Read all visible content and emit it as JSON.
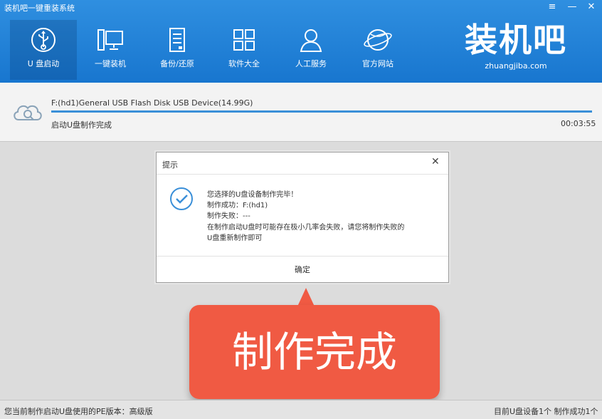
{
  "titlebar": {
    "app_title": "装机吧一键重装系统",
    "menu_icon": "≡",
    "minimize_icon": "—",
    "close_icon": "✕"
  },
  "nav": [
    {
      "label": "U 盘启动",
      "icon": "usb-icon",
      "active": true
    },
    {
      "label": "一键装机",
      "icon": "computer-icon"
    },
    {
      "label": "备份/还原",
      "icon": "backup-icon"
    },
    {
      "label": "软件大全",
      "icon": "apps-grid-icon"
    },
    {
      "label": "人工服务",
      "icon": "person-icon"
    },
    {
      "label": "官方网站",
      "icon": "globe-icon"
    }
  ],
  "brand": {
    "logo_text": "装机吧",
    "url": "zhuangjiba.com"
  },
  "device": {
    "name": "F:(hd1)General USB Flash Disk USB Device(14.99G)",
    "status": "启动U盘制作完成",
    "elapsed": "00:03:55",
    "progress": 1.0
  },
  "dialog": {
    "title": "提示",
    "close_icon": "✕",
    "lines": [
      "您选择的U盘设备制作完毕！",
      "制作成功：F:(hd1)",
      "制作失败：---",
      "在制作启动U盘时可能存在极小几率会失败，请您将制作失败的",
      "U盘重新制作即可"
    ],
    "ok_label": "确定"
  },
  "callout": {
    "text": "制作完成"
  },
  "statusbar": {
    "pe_info": "您当前制作启动U盘使用的PE版本：高级版",
    "count_info": "目前U盘设备1个 制作成功1个"
  },
  "colors": {
    "header": "#1f7fd6",
    "accent": "#3a8fd8",
    "callout": "#f05a43"
  }
}
